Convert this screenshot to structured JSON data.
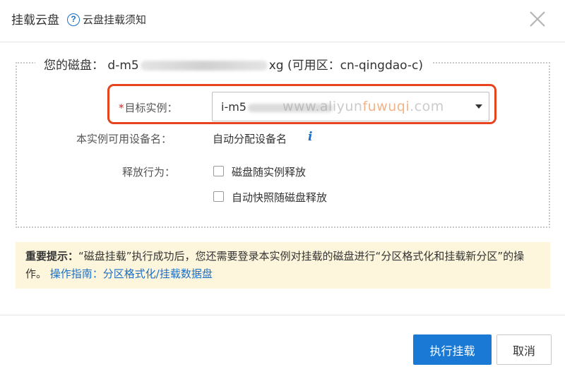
{
  "dialog": {
    "title": "挂载云盘",
    "help_link": "云盘挂载须知",
    "help_icon": "question-circle-icon",
    "close_icon": "close-icon"
  },
  "disk": {
    "label": "您的磁盘：",
    "id_prefix": "d-m5",
    "id_suffix": "xg",
    "zone": "(可用区：cn-qingdao-c)"
  },
  "form": {
    "target_instance": {
      "required_mark": "*",
      "label": "目标实例：",
      "value_prefix": "i-m5"
    },
    "device_name": {
      "label": "本实例可用设备名：",
      "value": "自动分配设备名",
      "info_icon": "i"
    },
    "release": {
      "label": "释放行为：",
      "options": [
        {
          "label": "磁盘随实例释放",
          "checked": false
        },
        {
          "label": "自动快照随磁盘释放",
          "checked": false
        }
      ]
    }
  },
  "watermark": {
    "part1": "www.aliyun",
    "part2": "fuwuqi",
    "part3": ".com"
  },
  "notice": {
    "bold": "重要提示：",
    "text": "“磁盘挂载”执行成功后，您还需要登录本实例对挂载的磁盘进行“分区格式化和挂载新分区”的操作。",
    "link": "操作指南：分区格式化/挂载数据盘"
  },
  "buttons": {
    "confirm": "执行挂载",
    "cancel": "取消"
  },
  "colors": {
    "primary": "#1b79d6",
    "highlight": "#e8431f",
    "notice_bg": "#fdf6dd",
    "link": "#1a6fc9",
    "required": "#e0251b"
  }
}
